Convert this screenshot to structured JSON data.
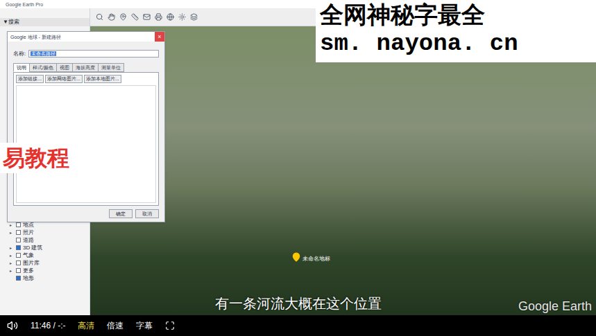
{
  "window": {
    "title": "Google Earth Pro"
  },
  "sidebar": {
    "search_header": "▼搜索",
    "layers": [
      {
        "label": "地点",
        "checked": false,
        "expandable": true
      },
      {
        "label": "照片",
        "checked": false,
        "expandable": true
      },
      {
        "label": "道路",
        "checked": false,
        "expandable": false
      },
      {
        "label": "3D 建筑",
        "checked": true,
        "expandable": true
      },
      {
        "label": "气象",
        "checked": false,
        "expandable": true
      },
      {
        "label": "图片库",
        "checked": false,
        "expandable": true
      },
      {
        "label": "更多",
        "checked": false,
        "expandable": true
      },
      {
        "label": "地形",
        "checked": true,
        "expandable": false
      }
    ]
  },
  "dialog": {
    "title": "Google 地球 - 新建路径",
    "close": "×",
    "name_label": "名称:",
    "name_value": "未命名路径",
    "tabs": [
      {
        "label": "说明",
        "selected": true
      },
      {
        "label": "样式/颜色",
        "selected": false
      },
      {
        "label": "视图",
        "selected": false
      },
      {
        "label": "海拔高度",
        "selected": false
      },
      {
        "label": "测量单位",
        "selected": false
      }
    ],
    "add_buttons": [
      "添加链接...",
      "添加网络图片...",
      "添加本地图片..."
    ],
    "buttons": [
      "确定",
      "取消"
    ]
  },
  "map": {
    "placemark_label": "未命名地标",
    "attribution": "Google Earth"
  },
  "overlays": {
    "watermark_lines": [
      "全网神秘字最全",
      "sm. nayona. cn"
    ],
    "side_banner": "易教程",
    "subtitle": "有一条河流大概在这个位置"
  },
  "player": {
    "time": "11:46 / -:-",
    "buttons": [
      {
        "label": "高清",
        "selected": true
      },
      {
        "label": "倍速",
        "selected": false
      },
      {
        "label": "字幕",
        "selected": false
      }
    ]
  }
}
